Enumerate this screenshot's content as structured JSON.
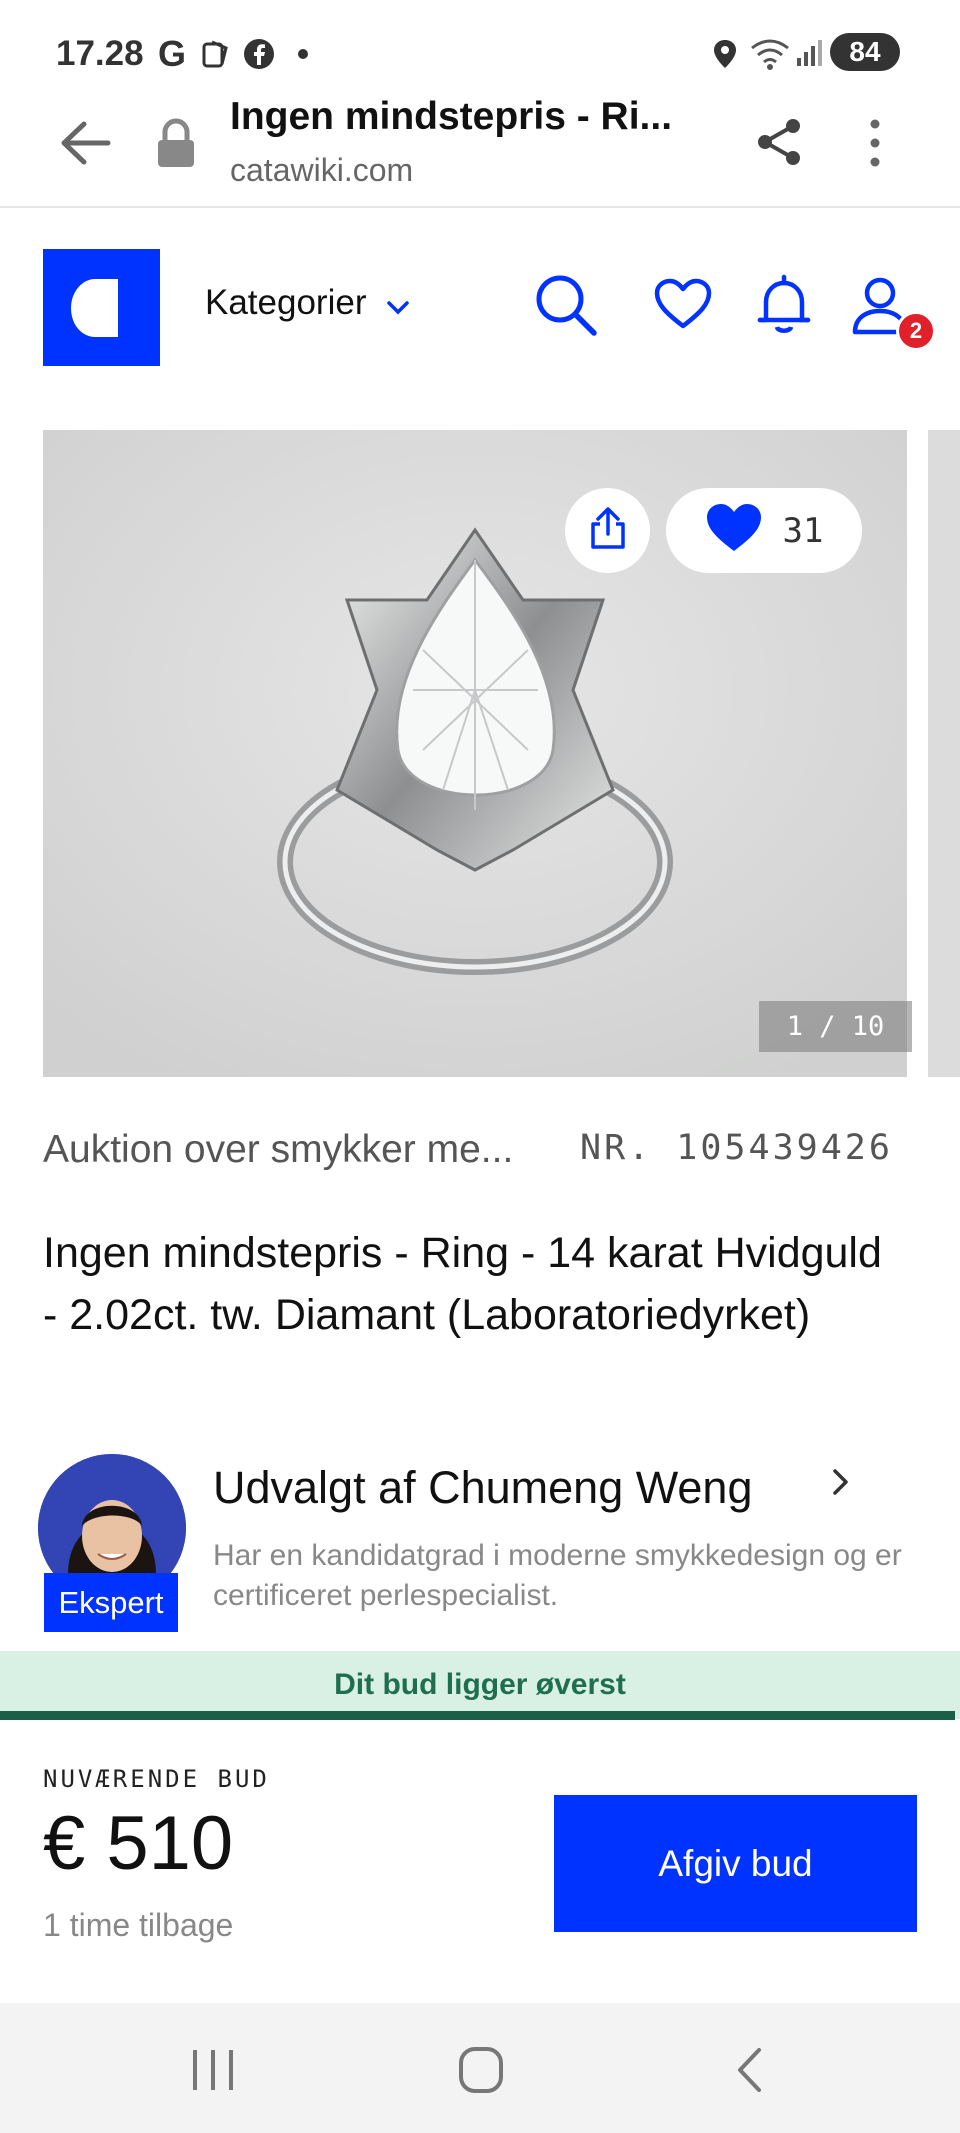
{
  "status_bar": {
    "time": "17.28",
    "battery": "84"
  },
  "browser": {
    "title": "Ingen mindstepris - Ri...",
    "url": "catawiki.com"
  },
  "header": {
    "categories_label": "Kategorier",
    "notification_badge": "2"
  },
  "gallery": {
    "favorite_count": "31",
    "counter": "1 / 10"
  },
  "lot": {
    "category": "Auktion over smykker me...",
    "number": "NR. 105439426",
    "title": "Ingen mindstepris - Ring - 14 karat Hvidguld - 2.02ct. tw. Diamant (Laboratoriedyrket)"
  },
  "expert": {
    "name": "Udvalgt af Chumeng Weng",
    "description": "Har en kandidatgrad i moderne smykkedesign og er certificeret perlespecialist.",
    "badge": "Ekspert"
  },
  "bid": {
    "banner": "Dit bud ligger øverst",
    "label": "NUVÆRENDE BUD",
    "amount": "€ 510",
    "time_left": "1 time tilbage",
    "button": "Afgiv bud"
  },
  "colors": {
    "brand_blue": "#0033ff",
    "banner_green": "#d9f0e4",
    "banner_text": "#1f6e52",
    "badge_red": "#e0202a"
  }
}
